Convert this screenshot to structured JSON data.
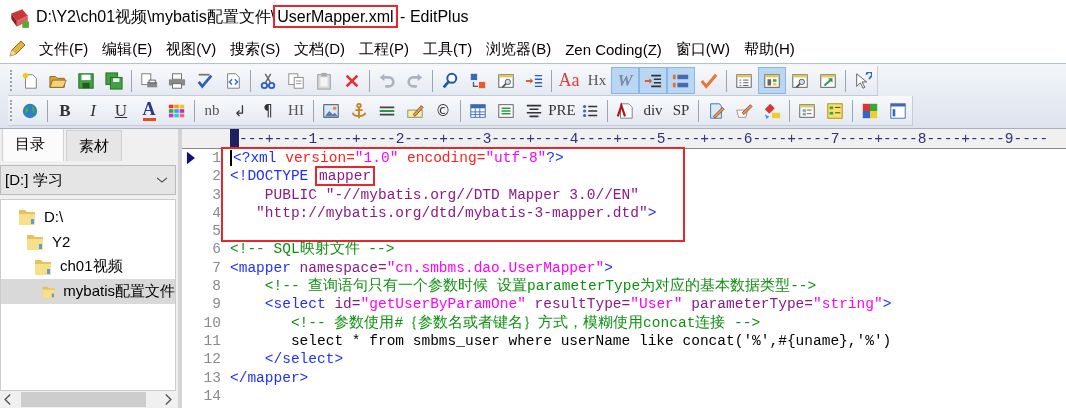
{
  "window": {
    "title_parts": [
      {
        "text": "D:\\Y2\\ch01视频\\mybatis配置文件\\",
        "highlighted": false
      },
      {
        "text": "UserMapper.xml",
        "highlighted": true
      },
      {
        "text": " - EditPlus",
        "highlighted": false
      }
    ]
  },
  "menu": [
    "文件(F)",
    "编辑(E)",
    "视图(V)",
    "搜索(S)",
    "文档(D)",
    "工程(P)",
    "工具(T)",
    "浏览器(B)",
    "Zen Coding(Z)",
    "窗口(W)",
    "帮助(H)"
  ],
  "toolbars": [
    {
      "items": [
        {
          "kind": "icon",
          "pressed": false
        },
        {
          "kind": "icon",
          "pressed": false
        },
        {
          "kind": "icon",
          "pressed": false
        },
        {
          "kind": "icon",
          "pressed": false
        },
        {
          "kind": "separator"
        },
        {
          "kind": "icon",
          "pressed": false
        },
        {
          "kind": "icon",
          "pressed": false
        },
        {
          "kind": "icon",
          "pressed": false
        },
        {
          "kind": "icon",
          "pressed": false
        },
        {
          "kind": "separator"
        },
        {
          "kind": "icon",
          "pressed": false
        },
        {
          "kind": "icon",
          "pressed": false
        },
        {
          "kind": "icon",
          "pressed": false
        },
        {
          "kind": "icon",
          "pressed": false
        },
        {
          "kind": "separator"
        },
        {
          "kind": "icon",
          "pressed": false
        },
        {
          "kind": "icon",
          "pressed": false
        },
        {
          "kind": "separator"
        },
        {
          "kind": "icon",
          "pressed": false
        },
        {
          "kind": "icon",
          "pressed": false
        },
        {
          "kind": "icon",
          "pressed": false
        },
        {
          "kind": "icon",
          "pressed": false
        },
        {
          "kind": "separator"
        },
        {
          "kind": "text",
          "label": "Aa",
          "pressed": false
        },
        {
          "kind": "text",
          "label": "Hx",
          "pressed": false
        },
        {
          "kind": "text",
          "label": "W",
          "pressed": true
        },
        {
          "kind": "icon",
          "pressed": true
        },
        {
          "kind": "icon",
          "pressed": true
        },
        {
          "kind": "icon",
          "pressed": false
        },
        {
          "kind": "separator"
        },
        {
          "kind": "icon",
          "pressed": false
        },
        {
          "kind": "icon",
          "pressed": true
        },
        {
          "kind": "icon",
          "pressed": false
        },
        {
          "kind": "icon",
          "pressed": false
        },
        {
          "kind": "separator"
        },
        {
          "kind": "icon",
          "pressed": false
        }
      ]
    },
    {
      "items": [
        {
          "kind": "icon",
          "pressed": false
        },
        {
          "kind": "separator"
        },
        {
          "kind": "text",
          "label": "B",
          "pressed": false
        },
        {
          "kind": "text",
          "label": "I",
          "pressed": false
        },
        {
          "kind": "text",
          "label": "U",
          "pressed": false
        },
        {
          "kind": "text",
          "label": "A",
          "pressed": false
        },
        {
          "kind": "icon",
          "pressed": false
        },
        {
          "kind": "separator"
        },
        {
          "kind": "text",
          "label": "nb",
          "pressed": false
        },
        {
          "kind": "text",
          "label": "↲",
          "pressed": false
        },
        {
          "kind": "text",
          "label": "¶",
          "pressed": false
        },
        {
          "kind": "text",
          "label": "HI",
          "pressed": false
        },
        {
          "kind": "separator"
        },
        {
          "kind": "icon",
          "pressed": false
        },
        {
          "kind": "icon",
          "pressed": false
        },
        {
          "kind": "icon",
          "pressed": false
        },
        {
          "kind": "icon",
          "pressed": false
        },
        {
          "kind": "text",
          "label": "©",
          "pressed": false
        },
        {
          "kind": "separator"
        },
        {
          "kind": "icon",
          "pressed": false
        },
        {
          "kind": "icon",
          "pressed": false
        },
        {
          "kind": "icon",
          "pressed": false
        },
        {
          "kind": "text",
          "label": "PRE",
          "pressed": false
        },
        {
          "kind": "icon",
          "pressed": false
        },
        {
          "kind": "separator"
        },
        {
          "kind": "icon",
          "pressed": false
        },
        {
          "kind": "text",
          "label": "div",
          "pressed": false
        },
        {
          "kind": "text",
          "label": "SP",
          "pressed": false
        },
        {
          "kind": "separator"
        },
        {
          "kind": "icon",
          "pressed": false
        },
        {
          "kind": "icon",
          "pressed": false
        },
        {
          "kind": "icon",
          "pressed": false
        },
        {
          "kind": "separator"
        },
        {
          "kind": "icon",
          "pressed": false
        },
        {
          "kind": "icon",
          "pressed": false
        },
        {
          "kind": "separator"
        },
        {
          "kind": "icon",
          "pressed": false
        },
        {
          "kind": "icon",
          "pressed": false
        }
      ]
    }
  ],
  "sidebar": {
    "tabs": [
      {
        "label": "目录",
        "selected": true
      },
      {
        "label": "素材",
        "selected": false
      }
    ],
    "drive": "[D:] 学习",
    "tree": [
      {
        "label": "D:\\",
        "selected": false,
        "children": [
          {
            "label": "Y2",
            "selected": false,
            "children": [
              {
                "label": "ch01视频",
                "selected": false,
                "children": [
                  {
                    "label": "mybatis配置文件",
                    "selected": true
                  }
                ]
              }
            ]
          }
        ]
      }
    ]
  },
  "editor": {
    "ruler": "---+----1----+----2----+----3----+----4----+----5----+----6----+----7----+----8----+----9----",
    "lines": [
      {
        "number": "1",
        "current": true,
        "in_box": true,
        "tokens": [
          {
            "text": "<?xml",
            "kind": "tag"
          },
          {
            "text": " version=",
            "kind": "pi_attr"
          },
          {
            "text": "\"1.0\"",
            "kind": "value"
          },
          {
            "text": " encoding=",
            "kind": "pi_attr"
          },
          {
            "text": "\"utf-8\"",
            "kind": "value"
          },
          {
            "text": "?>",
            "kind": "tag"
          }
        ]
      },
      {
        "number": "2",
        "current": false,
        "in_box": true,
        "tokens": [
          {
            "text": "<!DOCTYPE ",
            "kind": "tag"
          },
          {
            "text": "mapper",
            "kind": "attr",
            "highlighted": true
          }
        ]
      },
      {
        "number": "3",
        "current": false,
        "in_box": true,
        "tokens": [
          {
            "text": "    PUBLIC \"-//mybatis.org//DTD Mapper 3.0//EN\"",
            "kind": "attr"
          }
        ]
      },
      {
        "number": "4",
        "current": false,
        "in_box": true,
        "tokens": [
          {
            "text": "   \"http://mybatis.org/dtd/mybatis-3-mapper.dtd\"",
            "kind": "attr"
          },
          {
            "text": ">",
            "kind": "tag"
          }
        ]
      },
      {
        "number": "5",
        "current": false,
        "in_box": true
      },
      {
        "number": "6",
        "current": false,
        "in_box": false,
        "tokens": [
          {
            "text": "<!-- SQL映射文件 -->",
            "kind": "comment"
          }
        ]
      },
      {
        "number": "7",
        "current": false,
        "in_box": false,
        "tokens": [
          {
            "text": "<mapper",
            "kind": "tag"
          },
          {
            "text": " namespace=",
            "kind": "attr"
          },
          {
            "text": "\"cn.smbms.dao.UserMapper\"",
            "kind": "value"
          },
          {
            "text": ">",
            "kind": "tag"
          }
        ]
      },
      {
        "number": "8",
        "current": false,
        "in_box": false,
        "tokens": [
          {
            "text": "    <!-- 查询语句只有一个参数时候 设置parameterType为对应的基本数据类型-->",
            "kind": "comment"
          }
        ]
      },
      {
        "number": "9",
        "current": false,
        "in_box": false,
        "tokens": [
          {
            "text": "    <select",
            "kind": "tag"
          },
          {
            "text": " id=",
            "kind": "attr"
          },
          {
            "text": "\"getUserByParamOne\"",
            "kind": "value"
          },
          {
            "text": " resultType=",
            "kind": "attr"
          },
          {
            "text": "\"User\"",
            "kind": "value"
          },
          {
            "text": " parameterType=",
            "kind": "attr"
          },
          {
            "text": "\"string\"",
            "kind": "value"
          },
          {
            "text": ">",
            "kind": "tag"
          }
        ]
      },
      {
        "number": "10",
        "current": false,
        "in_box": false,
        "tokens": [
          {
            "text": "       <!-- 参数使用#｛参数名或者键名｝方式，模糊使用concat连接 -->",
            "kind": "comment"
          }
        ]
      },
      {
        "number": "11",
        "current": false,
        "in_box": false,
        "tokens": [
          {
            "text": "       select * from smbms_user where userName like concat('%',#{uname},'%')",
            "kind": "text"
          }
        ]
      },
      {
        "number": "12",
        "current": false,
        "in_box": false,
        "tokens": [
          {
            "text": "    </select>",
            "kind": "tag"
          }
        ]
      },
      {
        "number": "13",
        "current": false,
        "in_box": false,
        "tokens": [
          {
            "text": "</mapper>",
            "kind": "tag"
          }
        ]
      },
      {
        "number": "14",
        "current": false,
        "in_box": false
      }
    ]
  }
}
